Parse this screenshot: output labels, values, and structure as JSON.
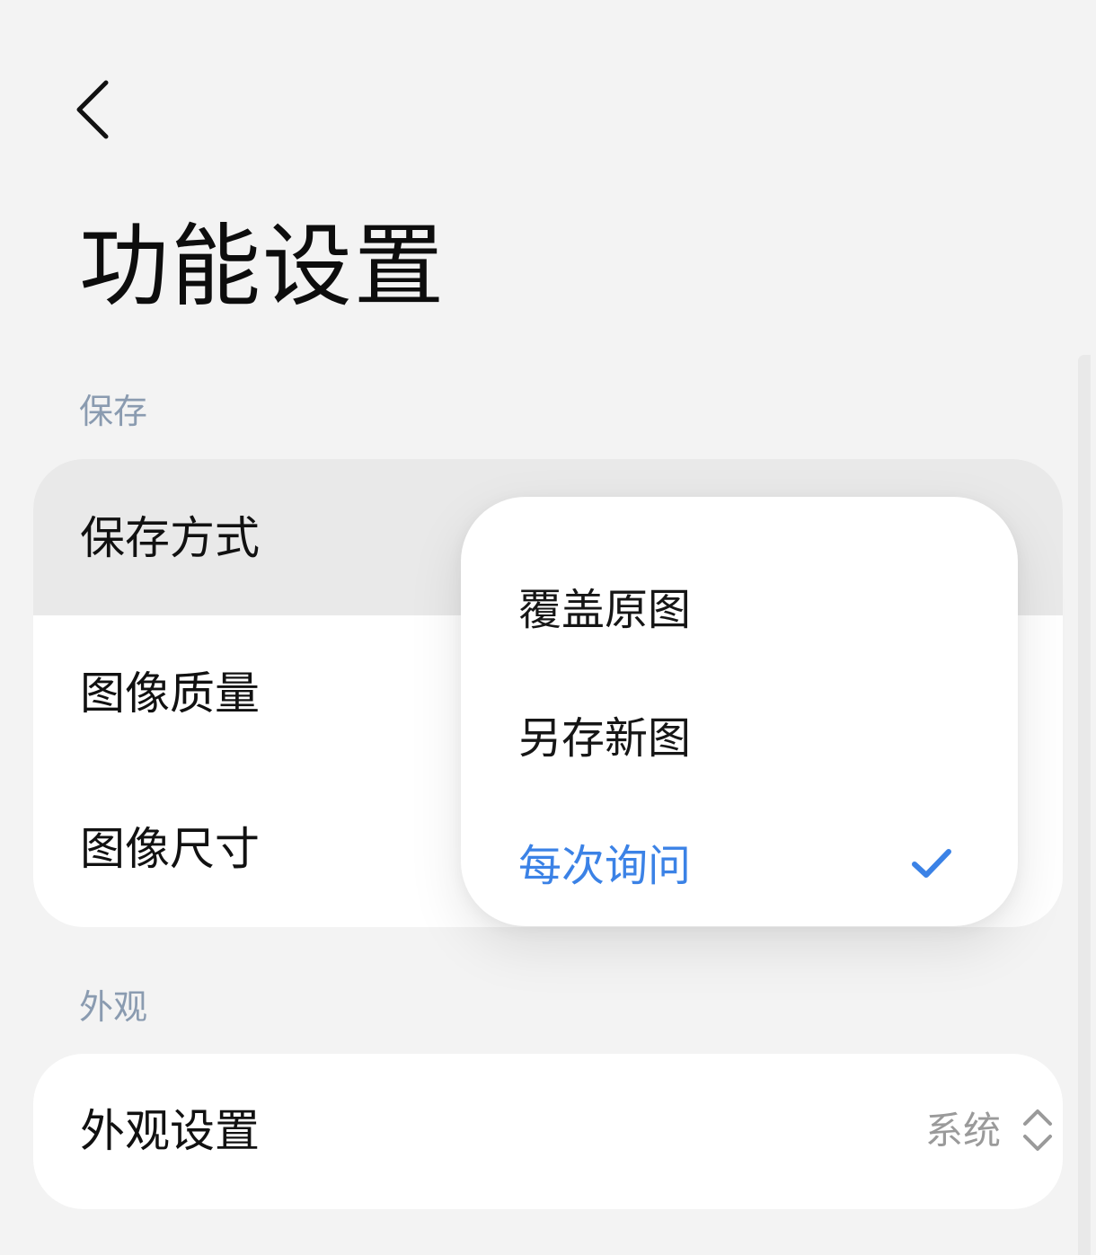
{
  "header": {
    "back_icon": "chevron-left-icon",
    "title": "功能设置"
  },
  "sections": {
    "save": {
      "label": "保存",
      "rows": [
        {
          "label": "保存方式",
          "pressed": true
        },
        {
          "label": "图像质量"
        },
        {
          "label": "图像尺寸"
        }
      ]
    },
    "appearance": {
      "label": "外观",
      "rows": [
        {
          "label": "外观设置",
          "value": "系统",
          "icon": "up-down-arrow-icon"
        }
      ]
    }
  },
  "popup": {
    "options": [
      {
        "label": "覆盖原图",
        "selected": false
      },
      {
        "label": "另存新图",
        "selected": false
      },
      {
        "label": "每次询问",
        "selected": true
      }
    ],
    "selected_icon": "checkmark-icon"
  },
  "colors": {
    "accent": "#3b82e6",
    "background": "#f3f3f3",
    "section_label": "#8a9bb0",
    "card": "#ffffff",
    "pressed_row": "#e9e9e9",
    "secondary_text": "#9a9a9a"
  }
}
